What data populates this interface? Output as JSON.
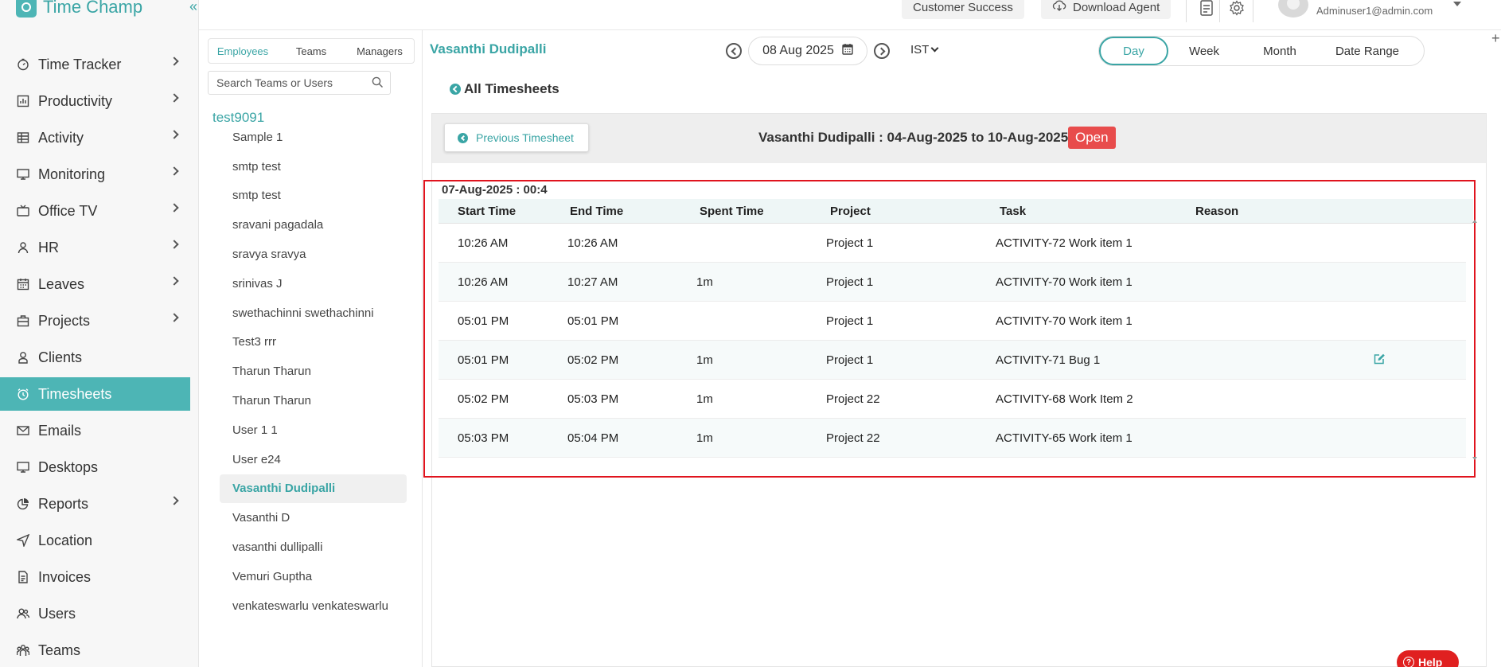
{
  "app": {
    "name": "Time Champ",
    "brand_color": "#4db5b5",
    "collapse_glyph": "«"
  },
  "sidebar": {
    "items": [
      {
        "label": "Time Tracker",
        "icon": "stopwatch-icon",
        "expandable": true
      },
      {
        "label": "Productivity",
        "icon": "bar-chart-icon",
        "expandable": true
      },
      {
        "label": "Activity",
        "icon": "activity-icon",
        "expandable": true
      },
      {
        "label": "Monitoring",
        "icon": "monitor-icon",
        "expandable": true
      },
      {
        "label": "Office TV",
        "icon": "tv-icon",
        "expandable": true
      },
      {
        "label": "HR",
        "icon": "person-icon",
        "expandable": true
      },
      {
        "label": "Leaves",
        "icon": "calendar-icon",
        "expandable": true
      },
      {
        "label": "Projects",
        "icon": "briefcase-icon",
        "expandable": true
      },
      {
        "label": "Clients",
        "icon": "client-icon",
        "expandable": false
      },
      {
        "label": "Timesheets",
        "icon": "clock-icon",
        "expandable": false,
        "active": true
      },
      {
        "label": "Emails",
        "icon": "mail-icon",
        "expandable": false
      },
      {
        "label": "Desktops",
        "icon": "desktop-icon",
        "expandable": false
      },
      {
        "label": "Reports",
        "icon": "pie-chart-icon",
        "expandable": true
      },
      {
        "label": "Location",
        "icon": "location-arrow-icon",
        "expandable": false
      },
      {
        "label": "Invoices",
        "icon": "invoice-icon",
        "expandable": false
      },
      {
        "label": "Users",
        "icon": "users-icon",
        "expandable": false
      },
      {
        "label": "Teams",
        "icon": "teams-icon",
        "expandable": false
      }
    ]
  },
  "topbar": {
    "customer_success": "Customer Success",
    "download_agent": "Download Agent",
    "user_email": "Adminuser1@admin.com"
  },
  "user_panel": {
    "tabs": [
      "Employees",
      "Teams",
      "Managers"
    ],
    "active_tab": "Employees",
    "search_placeholder": "Search Teams or Users",
    "group": "test9091",
    "users": [
      "Sample 1",
      "smtp test",
      "smtp test",
      "sravani pagadala",
      "sravya sravya",
      "srinivas J",
      "swethachinni swethachinni",
      "Test3 rrr",
      "Tharun Tharun",
      "Tharun Tharun",
      "User 1 1",
      "User e24",
      "Vasanthi Dudipalli",
      "Vasanthi D",
      "vasanthi dullipalli",
      "Vemuri Guptha",
      "venkateswarlu venkateswarlu"
    ],
    "selected_user": "Vasanthi Dudipalli"
  },
  "main": {
    "employee_name": "Vasanthi Dudipalli",
    "date": "08 Aug 2025",
    "timezone": "IST",
    "ranges": [
      "Day",
      "Week",
      "Month",
      "Date Range"
    ],
    "active_range": "Day",
    "back_link": "All Timesheets",
    "previous_button": "Previous Timesheet",
    "sheet_title": "Vasanthi Dudipalli : 04-Aug-2025 to 10-Aug-2025",
    "status": "Open",
    "status_color": "#e84c4c",
    "day_title": "07-Aug-2025 : 00:4",
    "columns": [
      "Start Time",
      "End Time",
      "Spent Time",
      "Project",
      "Task",
      "Reason"
    ],
    "rows": [
      {
        "start": "10:26 AM",
        "end": "10:26 AM",
        "spent": "",
        "project": "Project 1",
        "task": "ACTIVITY-72 Work item 1",
        "reason": "",
        "editable": false
      },
      {
        "start": "10:26 AM",
        "end": "10:27 AM",
        "spent": "1m",
        "project": "Project 1",
        "task": "ACTIVITY-70 Work item 1",
        "reason": "",
        "editable": false
      },
      {
        "start": "05:01 PM",
        "end": "05:01 PM",
        "spent": "",
        "project": "Project 1",
        "task": "ACTIVITY-70 Work item 1",
        "reason": "",
        "editable": false
      },
      {
        "start": "05:01 PM",
        "end": "05:02 PM",
        "spent": "1m",
        "project": "Project 1",
        "task": "ACTIVITY-71 Bug 1",
        "reason": "",
        "editable": true
      },
      {
        "start": "05:02 PM",
        "end": "05:03 PM",
        "spent": "1m",
        "project": "Project 22",
        "task": "ACTIVITY-68 Work Item 2",
        "reason": "",
        "editable": false
      },
      {
        "start": "05:03 PM",
        "end": "05:04 PM",
        "spent": "1m",
        "project": "Project 22",
        "task": "ACTIVITY-65 Work item 1",
        "reason": "",
        "editable": false
      }
    ]
  },
  "help_label": "Help",
  "top_right_plus": "+"
}
